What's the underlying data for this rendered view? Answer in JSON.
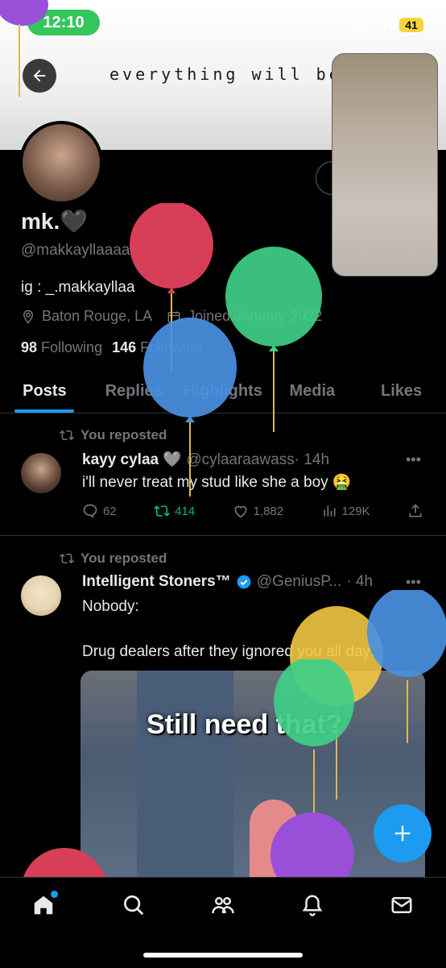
{
  "status_bar": {
    "time": "12:10",
    "network": "LTE",
    "battery": "41"
  },
  "banner": {
    "text": "everything will be ok"
  },
  "profile": {
    "name": "mk.🖤",
    "handle": "@makkayllaaaaa",
    "bio": "ig : _.makkayllaa",
    "location": "Baton Rouge, LA",
    "joined": "Joined January 2022",
    "following_count": "98",
    "following_label": "Following",
    "followers_count": "146",
    "followers_label": "Followers"
  },
  "tabs": [
    {
      "label": "Posts",
      "active": true
    },
    {
      "label": "Replies",
      "active": false
    },
    {
      "label": "Highlights",
      "active": false
    },
    {
      "label": "Media",
      "active": false
    },
    {
      "label": "Likes",
      "active": false
    }
  ],
  "posts": [
    {
      "repost_label": "You reposted",
      "author": "kayy cylaa 🩶",
      "handle": "@cylaaraawass",
      "time": "· 14h",
      "text": "i'll never treat my stud like she a boy 🤮",
      "replies": "62",
      "reposts": "414",
      "likes": "1,882",
      "views": "129K"
    },
    {
      "repost_label": "You reposted",
      "author": "Intelligent Stoners™",
      "handle": "@GeniusP...",
      "time": "· 4h",
      "text_line1": "Nobody:",
      "text_line2": "Drug dealers after they ignored you all day:",
      "media_caption": "Still need that?"
    }
  ],
  "colors": {
    "accent": "#1d9bf0",
    "repost_green": "#00ba7c",
    "muted": "#71767b"
  },
  "icons": {
    "back": "arrow-left-icon",
    "location": "location-pin-icon",
    "calendar": "calendar-icon",
    "repost": "repost-icon",
    "more": "more-dots-icon",
    "verified": "verified-badge-icon",
    "reply": "reply-bubble-icon",
    "like": "heart-icon",
    "views": "views-chart-icon",
    "share": "share-icon",
    "fab": "plus-icon",
    "nav": [
      "home-icon",
      "search-icon",
      "communities-icon",
      "notifications-icon",
      "messages-icon"
    ]
  }
}
